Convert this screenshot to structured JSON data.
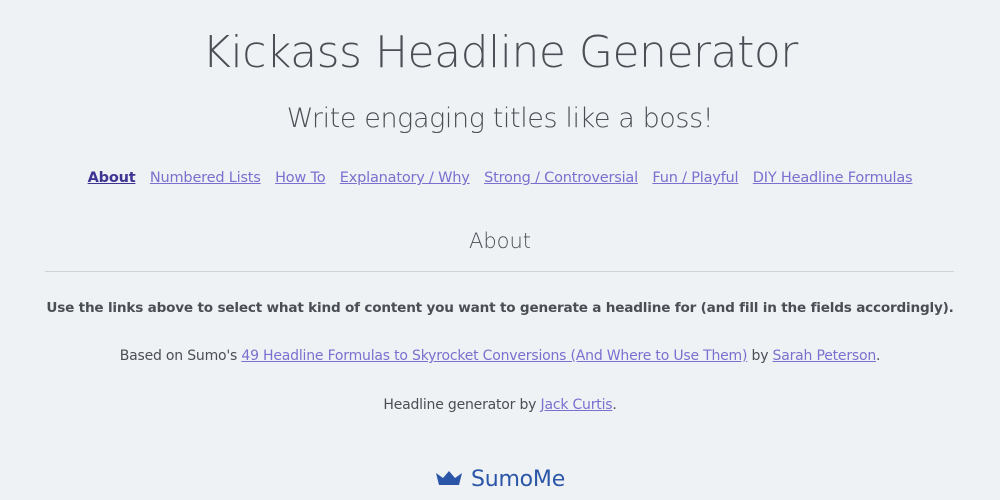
{
  "header": {
    "title": "Kickass Headline Generator",
    "subtitle": "Write engaging titles like a boss!"
  },
  "nav": {
    "items": [
      {
        "label": "About",
        "active": true
      },
      {
        "label": "Numbered Lists",
        "active": false
      },
      {
        "label": "How To",
        "active": false
      },
      {
        "label": "Explanatory / Why",
        "active": false
      },
      {
        "label": "Strong / Controversial",
        "active": false
      },
      {
        "label": "Fun / Playful",
        "active": false
      },
      {
        "label": "DIY Headline Formulas",
        "active": false
      }
    ]
  },
  "section": {
    "title": "About",
    "intro": "Use the links above to select what kind of content you want to generate a headline for (and fill in the fields accordingly).",
    "credit": {
      "prefix": "Based on Sumo's ",
      "article_link": "49 Headline Formulas to Skyrocket Conversions (And Where to Use Them)",
      "middle": " by ",
      "author_link": "Sarah Peterson",
      "suffix": "."
    },
    "generator_credit": {
      "prefix": "Headline generator by ",
      "author_link": "Jack Curtis",
      "suffix": "."
    }
  },
  "footer": {
    "brand_icon": "crown-icon",
    "brand_name": "SumoMe"
  },
  "colors": {
    "background": "#eff2f5",
    "text": "#4a4f55",
    "link": "#7b6fcf",
    "link_active": "#3e3493",
    "brand": "#2b56a8"
  }
}
